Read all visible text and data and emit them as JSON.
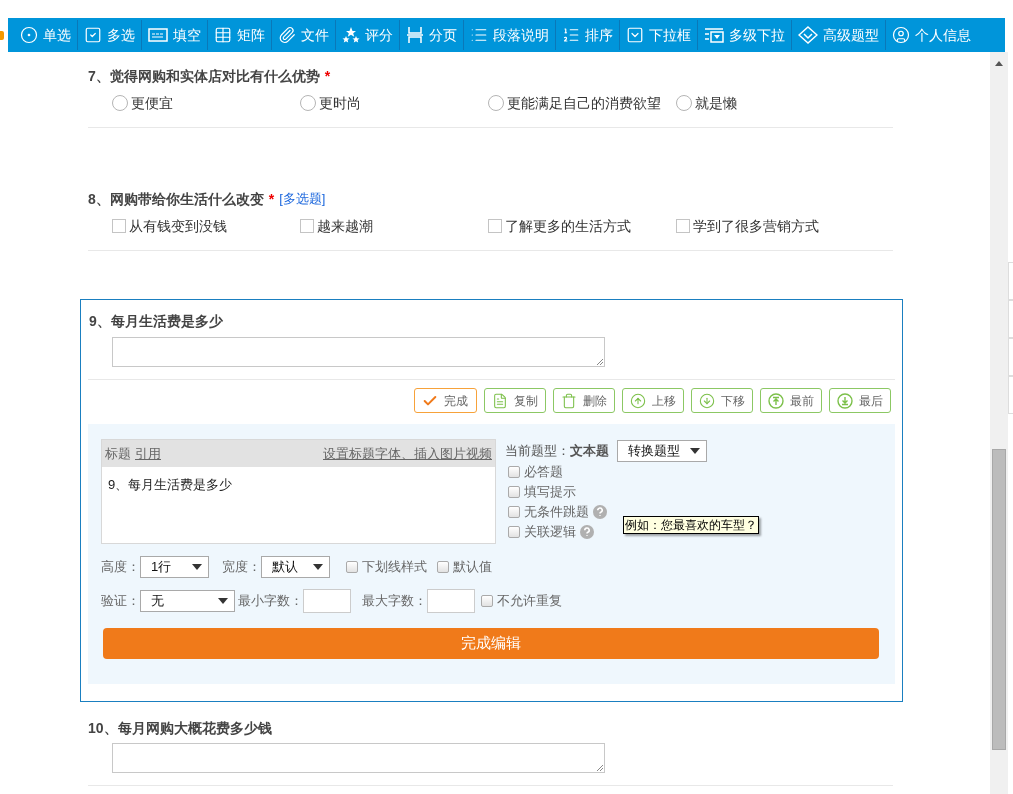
{
  "toolbar": [
    {
      "label": "单选"
    },
    {
      "label": "多选"
    },
    {
      "label": "填空"
    },
    {
      "label": "矩阵"
    },
    {
      "label": "文件"
    },
    {
      "label": "评分"
    },
    {
      "label": "分页"
    },
    {
      "label": "段落说明"
    },
    {
      "label": "排序"
    },
    {
      "label": "下拉框"
    },
    {
      "label": "多级下拉"
    },
    {
      "label": "高级题型"
    },
    {
      "label": "个人信息"
    }
  ],
  "questions": [
    {
      "kind": "radio",
      "title": "7、觉得网购和实体店对比有什么优势",
      "required_mark": "*",
      "options": [
        {
          "label": "更便宜",
          "checked": false
        },
        {
          "label": "更时尚",
          "checked": false
        },
        {
          "label": "更能满足自己的消费欲望",
          "checked": false
        },
        {
          "label": "就是懒",
          "checked": false
        }
      ]
    },
    {
      "kind": "checkbox",
      "title": "8、网购带给你生活什么改变",
      "required_mark": "*",
      "tag": "[多选题]",
      "options": [
        {
          "label": "从有钱变到没钱",
          "checked": false
        },
        {
          "label": "越来越潮",
          "checked": false
        },
        {
          "label": "了解更多的生活方式",
          "checked": false
        },
        {
          "label": "学到了很多营销方式",
          "checked": false
        }
      ]
    },
    {
      "kind": "editing",
      "title": "9、每月生活费是多少"
    },
    {
      "kind": "text",
      "title": "10、每月网购大概花费多少钱"
    }
  ],
  "editor": {
    "action_buttons": [
      {
        "label": "完成",
        "kind": "done"
      },
      {
        "label": "复制",
        "kind": "copy"
      },
      {
        "label": "删除",
        "kind": "delete"
      },
      {
        "label": "上移",
        "kind": "up"
      },
      {
        "label": "下移",
        "kind": "down"
      },
      {
        "label": "最前",
        "kind": "first"
      },
      {
        "label": "最后",
        "kind": "last"
      }
    ],
    "title_label": "标题",
    "quote_link": "引用",
    "font_link": "设置标题字体、插入图片视频",
    "title_value": "9、每月生活费是多少",
    "type_label": "当前题型：",
    "type_value": "文本题",
    "convert_select": "转换题型",
    "options": [
      {
        "label": "必答题",
        "checked": false,
        "help": false
      },
      {
        "label": "填写提示",
        "checked": false,
        "help": false
      },
      {
        "label": "无条件跳题",
        "checked": false,
        "help": true
      },
      {
        "label": "关联逻辑",
        "checked": false,
        "help": true
      }
    ],
    "tooltip": "例如：您最喜欢的车型？",
    "height_label": "高度：",
    "height_value": "1行",
    "width_label": "宽度：",
    "width_value": "默认",
    "underline": {
      "label": "下划线样式",
      "checked": false
    },
    "default_value": {
      "label": "默认值",
      "checked": false
    },
    "validate_label": "验证：",
    "validate_value": "无",
    "min_label": "最小字数：",
    "max_label": "最大字数：",
    "no_repeat": {
      "label": "不允许重复",
      "checked": false
    },
    "finish_button": "完成编辑"
  }
}
